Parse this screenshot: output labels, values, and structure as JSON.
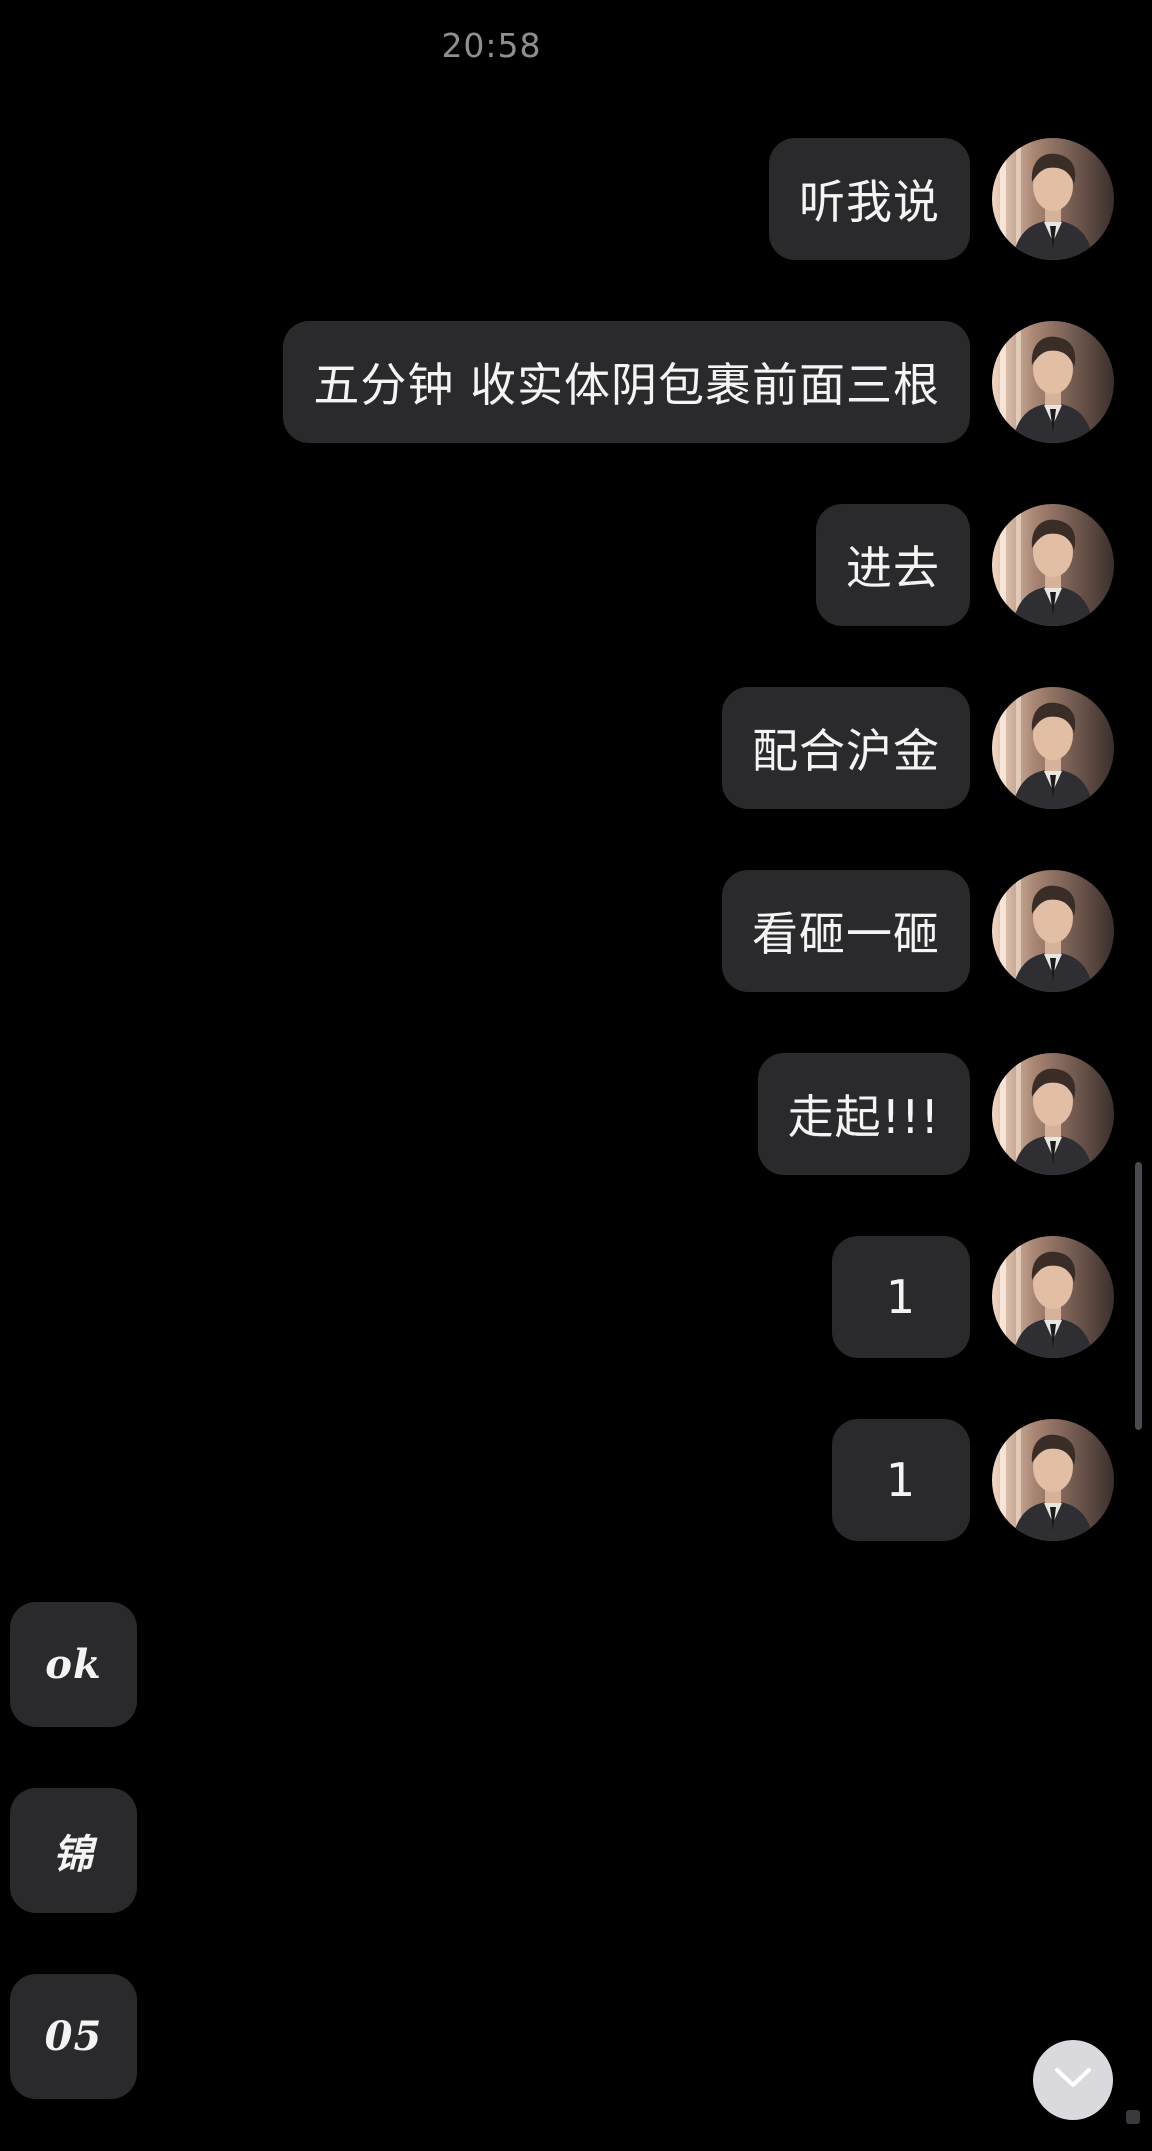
{
  "header": {
    "time": "20:58"
  },
  "messages_out": [
    {
      "text": "听我说"
    },
    {
      "text": "五分钟 收实体阴包裹前面三根"
    },
    {
      "text": "进去"
    },
    {
      "text": "配合沪金"
    },
    {
      "text": "看砸一砸"
    },
    {
      "text": "走起!!!"
    },
    {
      "text": "1"
    },
    {
      "text": "1"
    }
  ],
  "messages_in": [
    {
      "text": "ok"
    },
    {
      "text": "锦"
    },
    {
      "text": "05"
    }
  ],
  "icons": {
    "avatar": "avatar-icon",
    "scroll_down": "chevron-down-icon"
  },
  "colors": {
    "background": "#000000",
    "bubble": "#2a2a2d",
    "text": "#f4f4f4",
    "timestamp": "#8e8e93"
  }
}
